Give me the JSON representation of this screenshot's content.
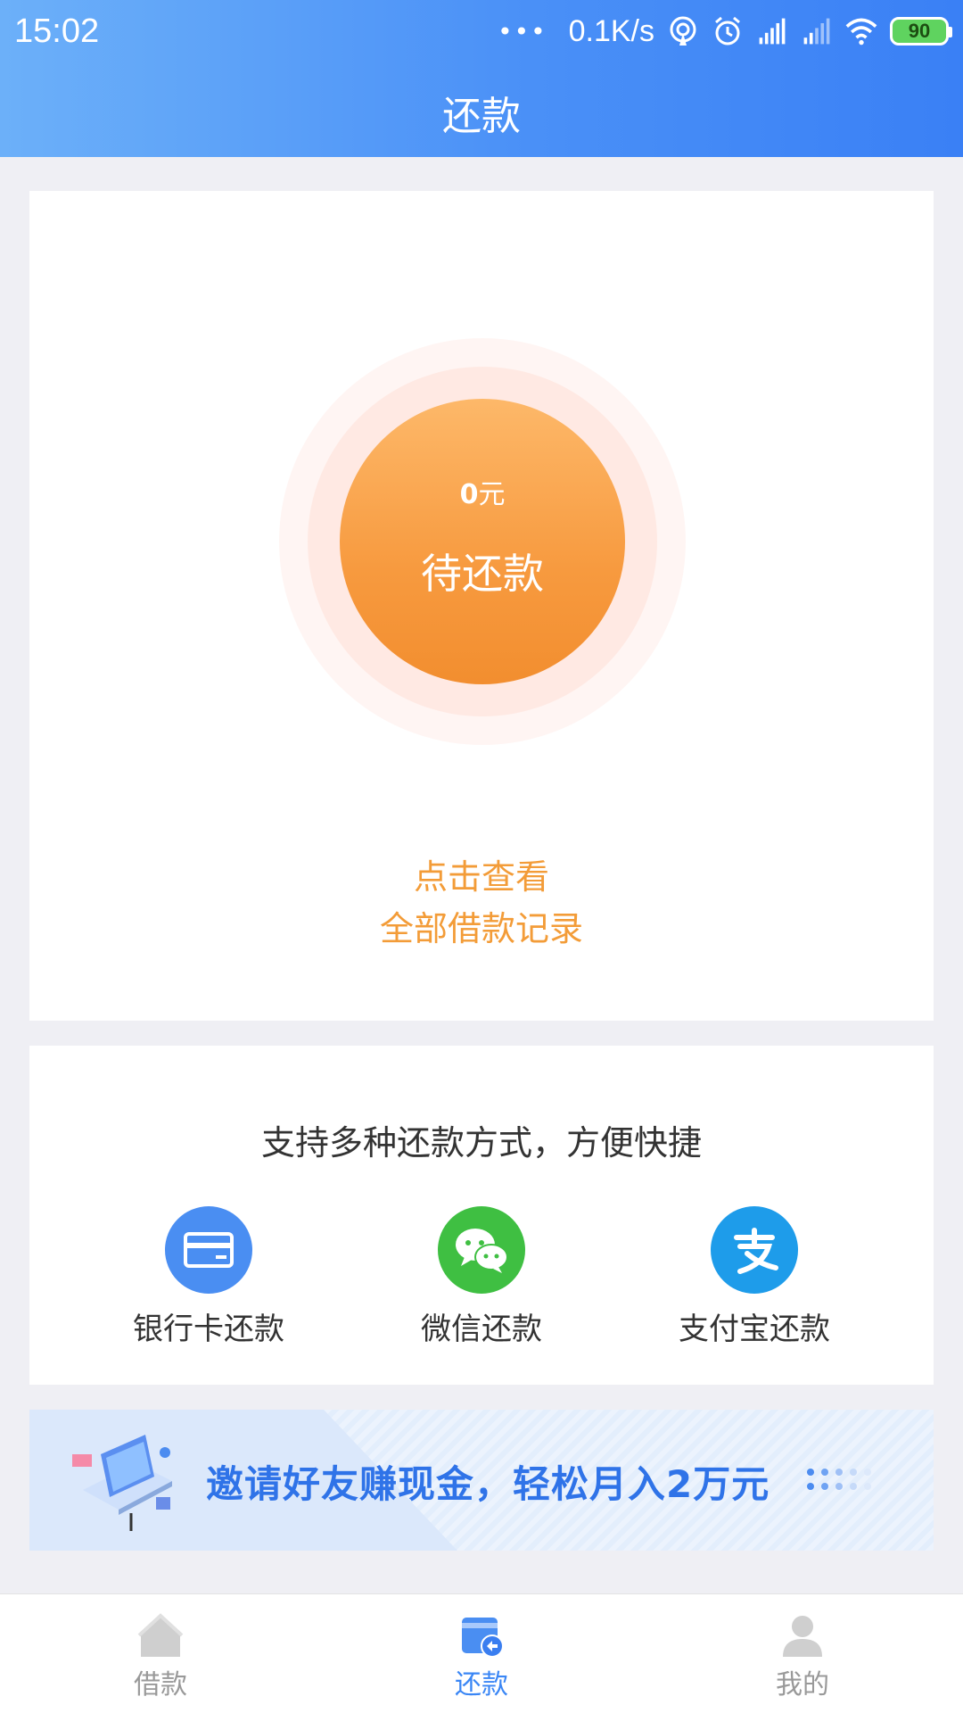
{
  "status_bar": {
    "time": "15:02",
    "dots": "•••",
    "speed": "0.1K/s",
    "battery": "90"
  },
  "header": {
    "title": "还款"
  },
  "summary": {
    "amount_value": "0",
    "amount_unit": "元",
    "pending_label": "待还款",
    "records_line1": "点击查看",
    "records_line2": "全部借款记录"
  },
  "methods": {
    "title": "支持多种还款方式，方便快捷",
    "items": [
      {
        "label": "银行卡还款",
        "icon": "bank-card-icon",
        "color": "#4a8ef2"
      },
      {
        "label": "微信还款",
        "icon": "wechat-icon",
        "color": "#3fbf42"
      },
      {
        "label": "支付宝还款",
        "icon": "alipay-icon",
        "color": "#1e9cea"
      }
    ]
  },
  "banner": {
    "text": "邀请好友赚现金，轻松月入2万元"
  },
  "bottom_nav": {
    "items": [
      {
        "label": "借款",
        "icon": "home-icon",
        "active": false
      },
      {
        "label": "还款",
        "icon": "repay-icon",
        "active": true
      },
      {
        "label": "我的",
        "icon": "user-icon",
        "active": false
      }
    ]
  },
  "colors": {
    "primary": "#3a86f5",
    "accent_orange": "#f39c38",
    "background": "#efeff4"
  }
}
